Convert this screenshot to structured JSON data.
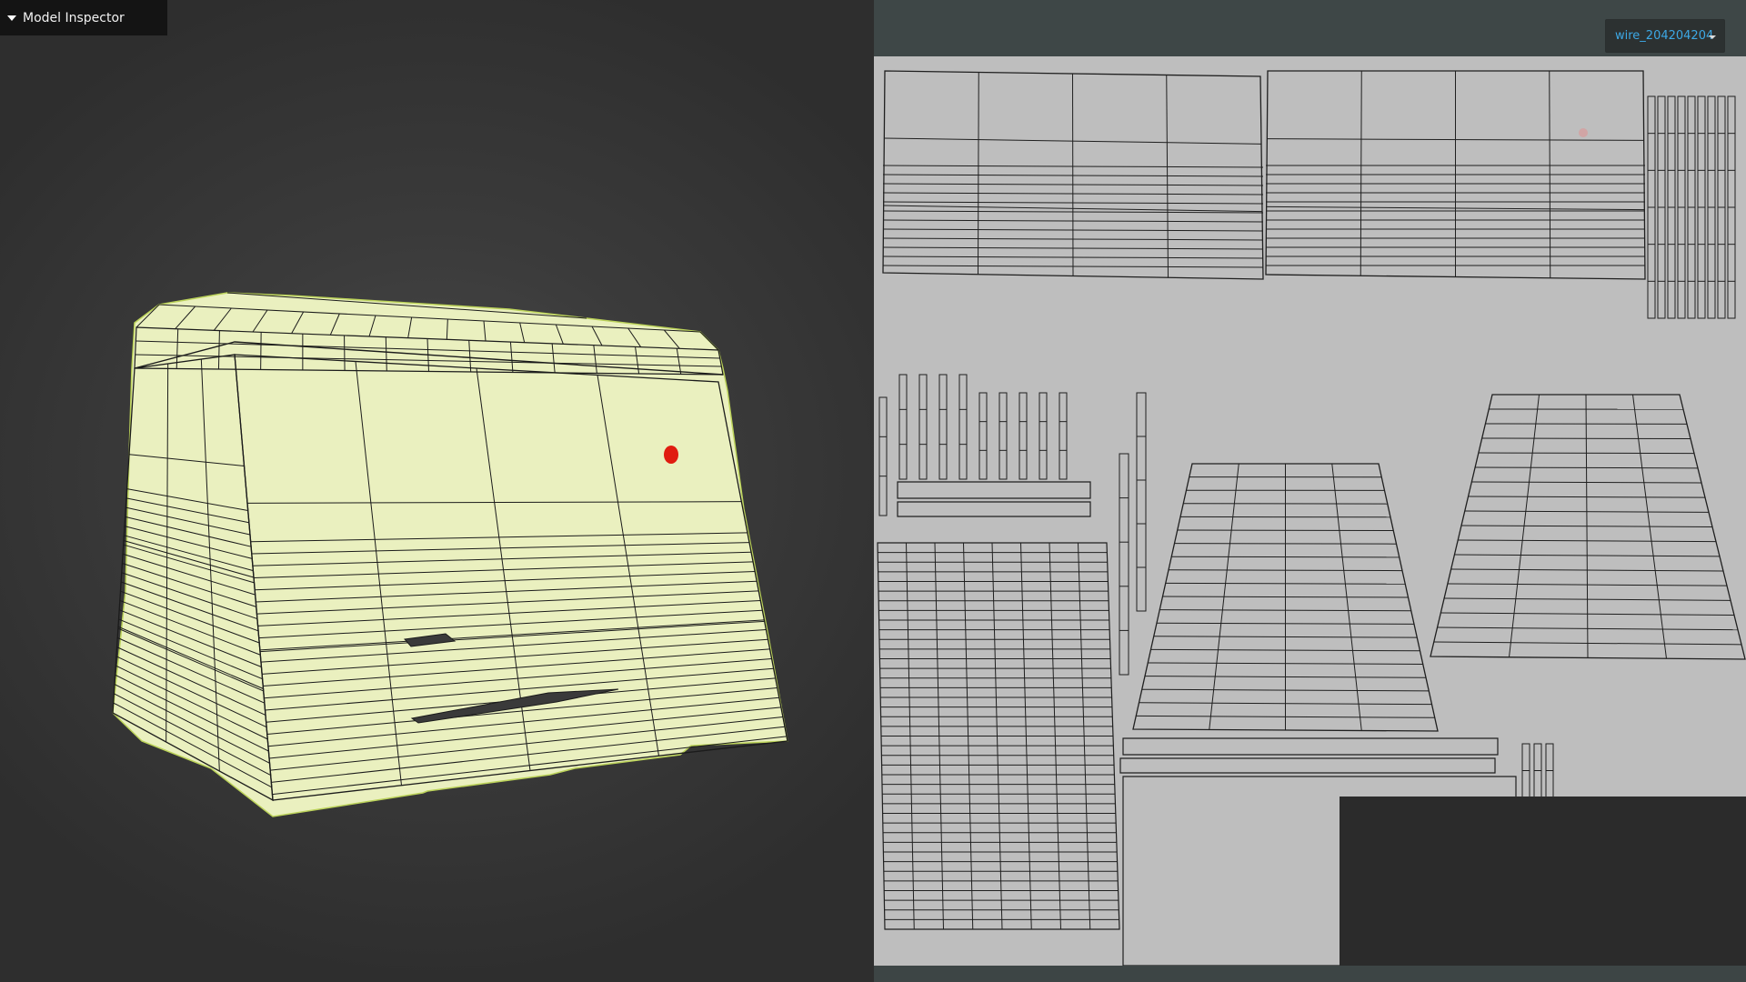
{
  "inspector": {
    "title": "Model Inspector",
    "expander_icon": "caret-down-icon"
  },
  "uv_view": {
    "material_select": {
      "value": "wire_204204204",
      "icon": "caret-down-icon"
    }
  },
  "colors": {
    "viewport_background": "#3b3b3b",
    "mesh_fill": "#eaf0bf",
    "mesh_wire": "#1b1b1b",
    "selection_marker": "#e01c10",
    "uv_background": "#bebebe",
    "uv_header": "#3e4747",
    "dropdown_text": "#3da8e5"
  }
}
